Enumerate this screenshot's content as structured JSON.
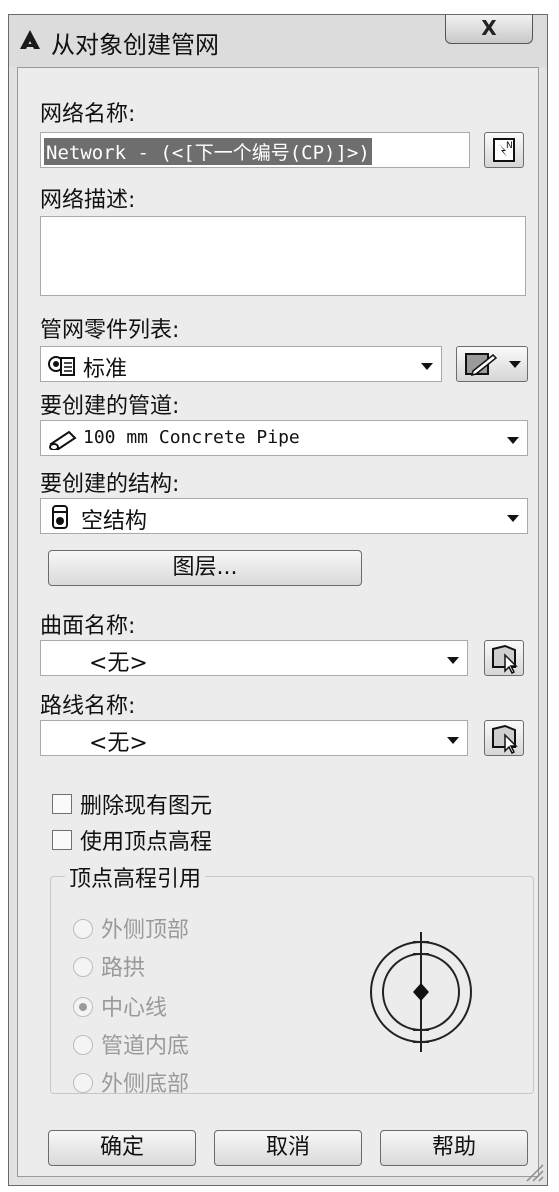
{
  "window": {
    "title": "从对象创建管网",
    "close_glyph": "X"
  },
  "network_name": {
    "label": "网络名称:",
    "value": "Network - (<[下一个编号(CP)]>)"
  },
  "network_desc": {
    "label": "网络描述:",
    "value": ""
  },
  "parts_list": {
    "label": "管网零件列表:",
    "value": "标准"
  },
  "pipe": {
    "label": "要创建的管道:",
    "value": "100 mm Concrete Pipe"
  },
  "structure": {
    "label": "要创建的结构:",
    "value": "空结构"
  },
  "layer_button": "图层...",
  "surface": {
    "label": "曲面名称:",
    "value": "<无>"
  },
  "alignment": {
    "label": "路线名称:",
    "value": "<无>"
  },
  "checkboxes": [
    {
      "label": "删除现有图元",
      "checked": false
    },
    {
      "label": "使用顶点高程",
      "checked": false
    }
  ],
  "vertex_elevation": {
    "title": "顶点高程引用",
    "options": [
      "外侧顶部",
      "路拱",
      "中心线",
      "管道内底",
      "外侧底部"
    ],
    "selected": "中心线"
  },
  "buttons": {
    "ok": "确定",
    "cancel": "取消",
    "help": "帮助"
  }
}
